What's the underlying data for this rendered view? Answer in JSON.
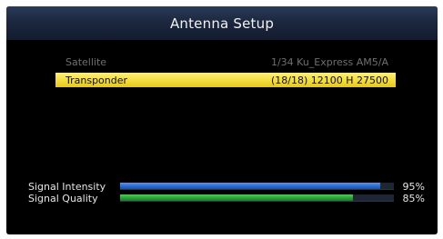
{
  "header": {
    "title": "Antenna Setup",
    "color": "#1c2840"
  },
  "menu": {
    "satellite": {
      "label": "Satellite",
      "value": "1/34 Ku_Express AM5/A"
    },
    "transponder": {
      "label": "Transponder",
      "value": "(18/18) 12100 H 27500",
      "highlight_color": "#f3dc3c"
    }
  },
  "signal": {
    "intensity": {
      "label": "Signal Intensity",
      "percent_text": "95%",
      "level": 0.95,
      "color": "#2f6fd4"
    },
    "quality": {
      "label": "Signal Quality",
      "percent_text": "85%",
      "level": 0.85,
      "color": "#2ea63a"
    }
  }
}
